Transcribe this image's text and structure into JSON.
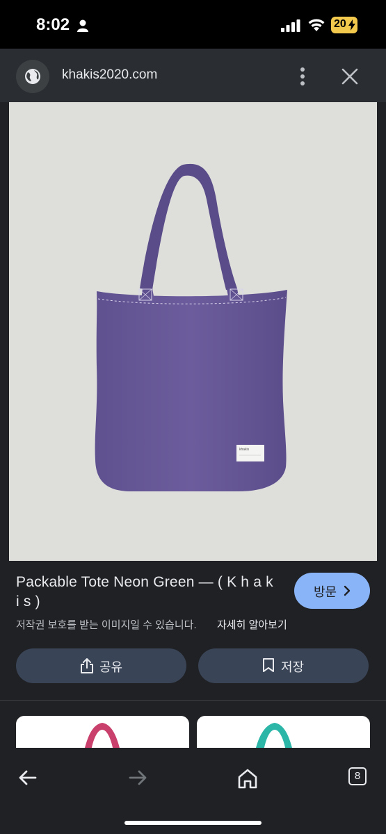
{
  "status_bar": {
    "time": "8:02",
    "battery": "20",
    "icons": [
      "person-icon",
      "signal-icon",
      "wifi-icon",
      "battery-charging-icon"
    ]
  },
  "browser": {
    "url": "khakis2020.com",
    "icons": [
      "globe-icon",
      "more-vert-icon",
      "close-icon"
    ]
  },
  "image": {
    "label_text": "khakis"
  },
  "result": {
    "title": "Packable Tote Neon Green — ( K h a k i s )",
    "visit_label": "방문",
    "copyright_notice": "저작권 보호를 받는 이미지일 수 있습니다.",
    "learn_more": "자세히 알아보기",
    "share_label": "공유",
    "save_label": "저장"
  },
  "colors": {
    "accent": "#8ab4f8",
    "background": "#202124",
    "action_button": "#394457",
    "tote_purple": "#6a5a9a"
  },
  "nav": {
    "tab_count": "8",
    "icons": [
      "back-arrow-icon",
      "forward-arrow-icon",
      "home-icon",
      "tabs-icon"
    ]
  }
}
